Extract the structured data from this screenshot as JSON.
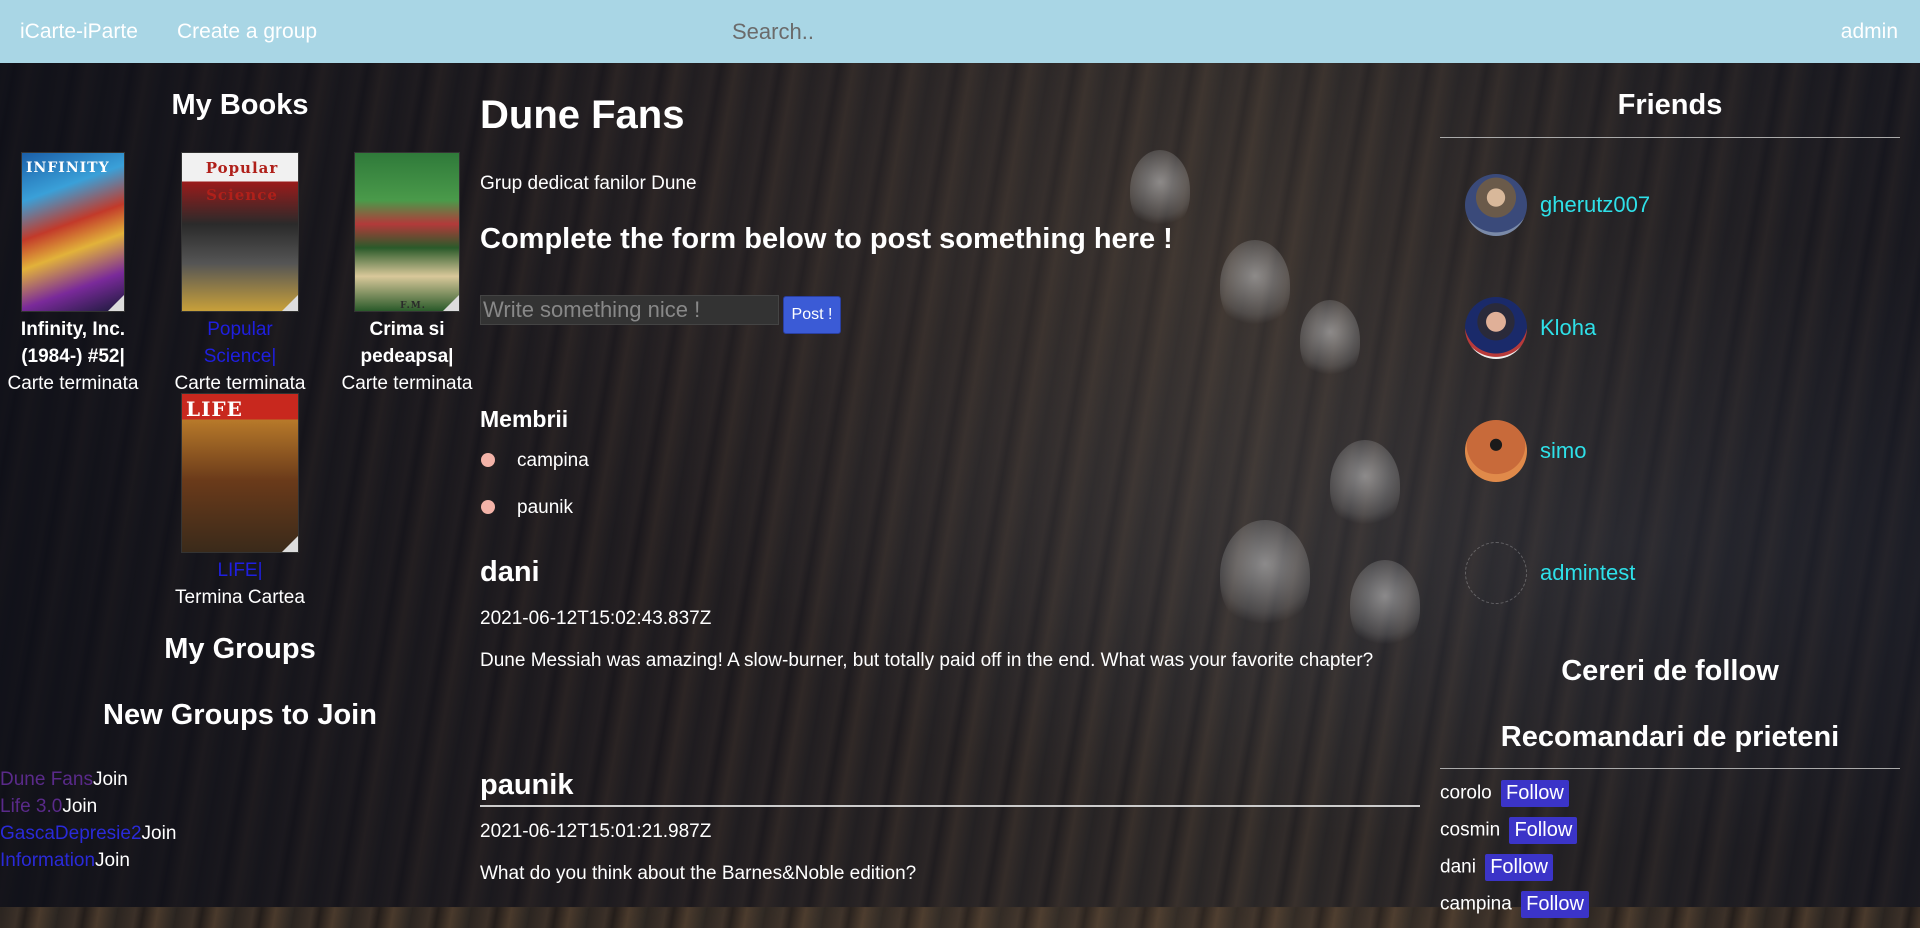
{
  "navbar": {
    "brand": "iCarte-iParte",
    "create_group": "Create a group",
    "search_placeholder": "Search..",
    "user": "admin"
  },
  "left": {
    "my_books_heading": "My Books",
    "books": [
      {
        "title": "Infinity, Inc. (1984-) #52|",
        "status": "Carte terminata",
        "cover_label": "INFINITY",
        "title_style": "white"
      },
      {
        "title": "Popular Science|",
        "status": "Carte terminata",
        "cover_label": "Popular Science",
        "title_style": "blue"
      },
      {
        "title": "Crima si pedeapsa|",
        "status": "Carte terminata",
        "cover_label": "F.M. DOSTOIEVSKI",
        "title_style": "white"
      },
      {
        "title": "LIFE|",
        "status": "Termina Cartea",
        "cover_label": "LIFE",
        "title_style": "blue"
      }
    ],
    "my_groups_heading": "My Groups",
    "new_groups_heading": "New Groups to Join",
    "new_groups": [
      {
        "name": "Dune Fans",
        "action": "Join"
      },
      {
        "name": "Life 3.0",
        "action": "Join"
      },
      {
        "name": "GascaDepresie2",
        "action": "Join"
      },
      {
        "name": "Information",
        "action": "Join"
      }
    ]
  },
  "group": {
    "title": "Dune Fans",
    "description": "Grup dedicat fanilor Dune",
    "form_heading": "Complete the form below to post something here !",
    "input_placeholder": "Write something nice !",
    "post_button": "Post !",
    "members_heading": "Membrii",
    "members": [
      "campina",
      "paunik"
    ],
    "posts": [
      {
        "author": "dani",
        "date": "2021-06-12T15:02:43.837Z",
        "text": "Dune Messiah was amazing! A slow-burner, but totally paid off in the end. What was your favorite chapter?"
      },
      {
        "author": "paunik",
        "date": "2021-06-12T15:01:21.987Z",
        "text": "What do you think about the Barnes&Noble edition?"
      }
    ]
  },
  "right": {
    "friends_heading": "Friends",
    "friends": [
      "gherutz007",
      "Kloha",
      "simo",
      "admintest"
    ],
    "follow_requests_heading": "Cereri de follow",
    "recommendations_heading": "Recomandari de prieteni",
    "recommendations": [
      {
        "name": "corolo",
        "action": "Follow"
      },
      {
        "name": "cosmin",
        "action": "Follow"
      },
      {
        "name": "dani",
        "action": "Follow"
      },
      {
        "name": "campina",
        "action": "Follow"
      }
    ]
  },
  "colors": {
    "navbar_bg": "#a9d6e5",
    "friend_link": "#2ee0e8",
    "follow_button": "#3b34c8",
    "post_button": "#3b5bd6",
    "group_link": "#2a2ad8"
  }
}
